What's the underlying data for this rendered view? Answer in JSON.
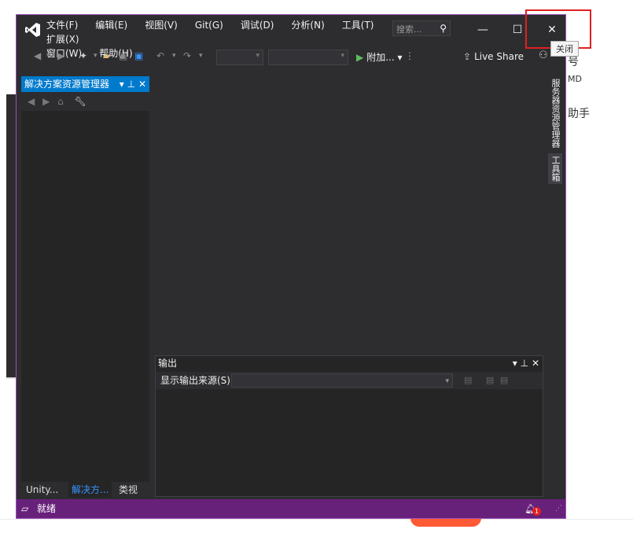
{
  "window": {
    "menu": [
      "文件(F)",
      "编辑(E)",
      "视图(V)",
      "Git(G)",
      "调试(D)",
      "分析(N)",
      "工具(T)",
      "扩展(X)",
      "窗口(W)",
      "帮助(H)"
    ],
    "search_placeholder": "搜索...",
    "controls": {
      "minimize": "—",
      "maximize": "☐",
      "close": "✕"
    },
    "close_tooltip": "关闭"
  },
  "toolbar": {
    "run_label": "附加...",
    "live_share": "Live Share"
  },
  "solution_explorer": {
    "title": "解决方案资源管理器",
    "tabs": [
      "Unity...",
      "解决方...",
      "类视图"
    ],
    "active_tab": 1
  },
  "side_tabs": [
    "服务器资源管理器",
    "工具箱"
  ],
  "output": {
    "title": "输出",
    "source_label": "显示输出来源(S):",
    "source_value": ""
  },
  "status": {
    "text": "就绪",
    "notification_count": "1"
  },
  "background": {
    "right_chars": [
      "号",
      "MD",
      "助手"
    ]
  },
  "colors": {
    "accent": "#007acc",
    "status_bar": "#68217a",
    "highlight_border": "#e02020"
  }
}
